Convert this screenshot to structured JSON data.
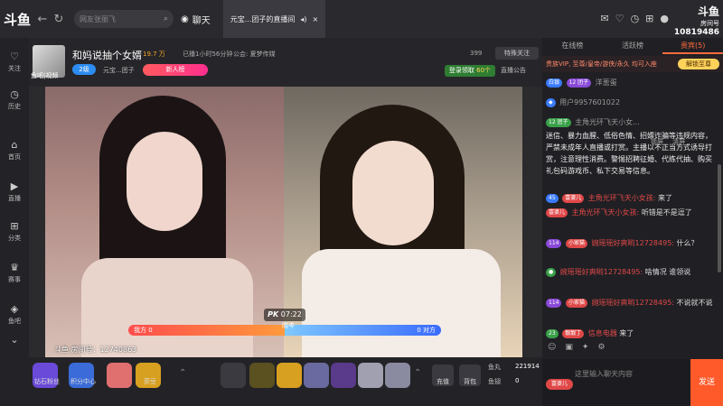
{
  "topbar": {
    "logo": "斗鱼",
    "search_placeholder": "网友张丽飞",
    "chat_tab": "聊天",
    "live_tab": "元宝...团子的直播间",
    "room_badge_top": "斗鱼",
    "room_badge_label": "房间号",
    "room_badge_number": "10819486"
  },
  "sidebar": {
    "items": [
      {
        "label": "关注",
        "icon": "heart-icon"
      },
      {
        "label": "历史",
        "icon": "clock-icon"
      },
      {
        "label": "首页",
        "icon": "home-icon"
      },
      {
        "label": "直播",
        "icon": "play-icon"
      },
      {
        "label": "分类",
        "icon": "grid-icon"
      },
      {
        "label": "赛事",
        "icon": "trophy-icon"
      },
      {
        "label": "鱼吧",
        "icon": "fish-icon"
      }
    ]
  },
  "roomhead": {
    "avatar_caption": "鱼吧|视频",
    "title": "和妈说抽个女婿",
    "hot": "19.7 万",
    "ontime": "已播1小时56分钟",
    "notice": "公会: 夏梦传媒",
    "level": "2级",
    "anchor": "元宝...团子",
    "newrank": "新人榜",
    "fans": "399",
    "follow": "特殊关注",
    "login_task": "登录领取",
    "login_task_value": "60个",
    "pub": "直播公告"
  },
  "video": {
    "pk_label": "PK",
    "pk_time": "07:22",
    "left_side": "我方 0",
    "right_side": "0 对方",
    "watermark": "斗鱼 房间号：12740863",
    "right_tag": "晓岑"
  },
  "giftbar": {
    "gifts": [
      {
        "label": "钻石粉丝"
      },
      {
        "label": "积分中心"
      },
      {
        "label": ""
      },
      {
        "label": "荧豆"
      }
    ],
    "recharge": "充值",
    "bag": "背包",
    "yuwan_label": "鱼丸",
    "yuwan_value": "221914",
    "yuchi_label": "鱼翅",
    "yuchi_value": "0"
  },
  "rpanel": {
    "tabs": [
      "在线榜",
      "活跃榜",
      "贵宾(5)"
    ],
    "vip_text": "贵族VIP, 至尊/皇帝/游侠/永久 均可入座",
    "unlock": "解锁至尊",
    "messages": [
      {
        "badge": "白银",
        "name": "12 团子",
        "text": "洋葱蛋"
      },
      {
        "badge": "",
        "name": "用户9957601022",
        "text": ""
      },
      {
        "badge": "",
        "name": "12 团子",
        "text": "主角光环飞天小女..."
      }
    ],
    "sysmsg": "迷信、暴力血腥、低俗色情、招嫖诈骗等违规内容，严禁未成年人直播或打赏。主播以不正当方式诱导打赏，注意理性消费。警惕招聘征婚、代练代抽、购买礼包码游戏币、私下交易等信息。",
    "chat": [
      {
        "lvl": "45",
        "badge": "富婆儿",
        "name": "主角光环飞天小女孩:",
        "text": "来了"
      },
      {
        "lvl": "",
        "badge": "富婆儿",
        "name": "主角光环飞天小女孩:",
        "text": "听错是不是逗了"
      },
      {
        "lvl": "114",
        "badge": "小家猫",
        "name": "婉瑶瑶好爽哟12728495:",
        "text": "什么？"
      },
      {
        "lvl": "",
        "badge": "",
        "name": "婉瑶瑶好爽哟12728495:",
        "text": "啥情况 谁领说"
      },
      {
        "lvl": "114",
        "badge": "小家猫",
        "name": "婉瑶瑶好爽哟12728495:",
        "text": "不说就不说"
      },
      {
        "lvl": "23",
        "badge": "靓靓丁",
        "name": "信息电器",
        "text": "来了"
      }
    ],
    "tools": [
      "锁屏",
      "清屏"
    ],
    "input_placeholder": "这里输入聊天内容",
    "fans_badge": "富婆儿",
    "send": "发送"
  }
}
